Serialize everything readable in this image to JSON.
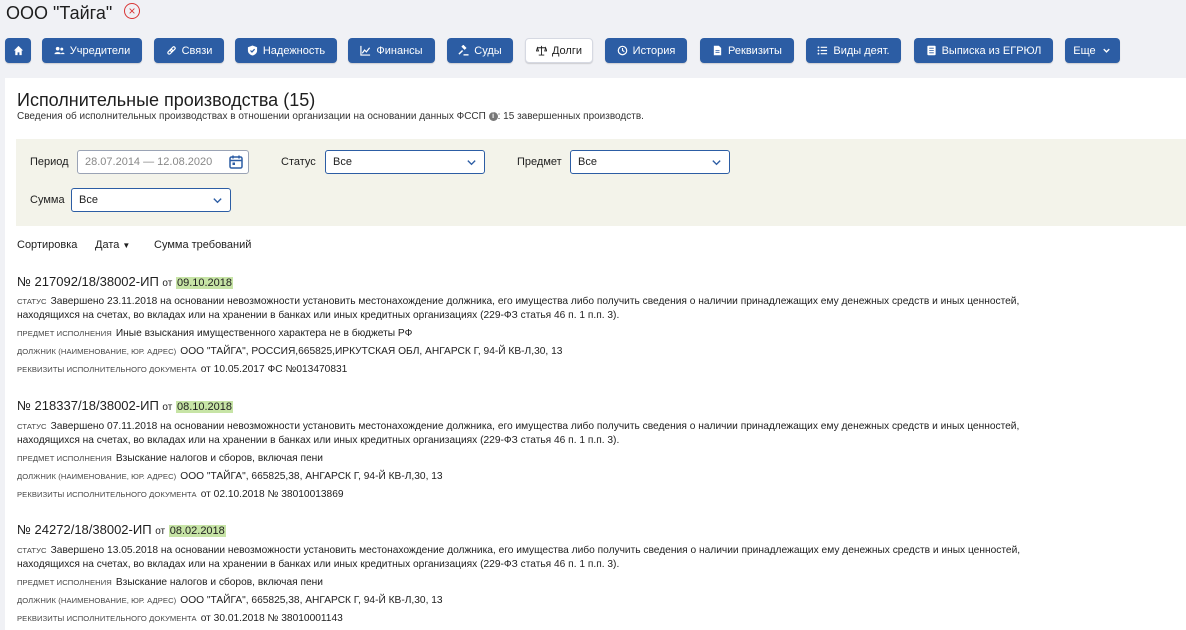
{
  "header": {
    "company": "ООО \"Тайга\"",
    "close_symbol": "×"
  },
  "nav": {
    "home_icon": "home-icon",
    "items": [
      {
        "label": "Учредители",
        "icon": "people-icon"
      },
      {
        "label": "Связи",
        "icon": "link-icon"
      },
      {
        "label": "Надежность",
        "icon": "shield-icon"
      },
      {
        "label": "Финансы",
        "icon": "chart-icon"
      },
      {
        "label": "Суды",
        "icon": "gavel-icon"
      },
      {
        "label": "Долги",
        "icon": "scales-icon",
        "active": true
      },
      {
        "label": "История",
        "icon": "history-icon"
      },
      {
        "label": "Реквизиты",
        "icon": "document-icon"
      },
      {
        "label": "Виды деят.",
        "icon": "list-icon"
      },
      {
        "label": "Выписка из ЕГРЮЛ",
        "icon": "extract-icon"
      },
      {
        "label": "Еще",
        "icon": "chevron-down-icon"
      }
    ],
    "accent": "#2c5da4"
  },
  "page": {
    "title": "Исполнительные производства (15)",
    "subtitle_before": "Сведения об исполнительных производствах в отношении организации на основании данных ФССП",
    "subtitle_after": ": 15 завершенных производств."
  },
  "filters": {
    "period_label": "Период",
    "period_value": "28.07.2014 — 12.08.2020",
    "status_label": "Статус",
    "status_value": "Все",
    "subject_label": "Предмет",
    "subject_value": "Все",
    "sum_label": "Сумма",
    "sum_value": "Все"
  },
  "sort": {
    "label": "Сортировка",
    "date": "Дата",
    "sum": "Сумма требований"
  },
  "labels": {
    "ot": "от",
    "status": "СТАТУС",
    "subject": "ПРЕДМЕТ ИСПОЛНЕНИЯ",
    "debtor": "ДОЛЖНИК (НАИМЕНОВАНИЕ, ЮР. АДРЕС)",
    "requisites": "РЕКВИЗИТЫ ИСПОЛНИТЕЛЬНОГО ДОКУМЕНТА"
  },
  "records": [
    {
      "number": "№ 217092/18/38002-ИП",
      "date": "09.10.2018",
      "status_line1": "Завершено 23.11.2018 на основании невозможности установить местонахождение должника, его имущества либо получить сведения о наличии принадлежащих ему денежных средств и иных ценностей,",
      "status_line2": "находящихся на счетах, во вкладах или на хранении в банках или иных кредитных организациях (229-ФЗ статья 46 п. 1 п.п. 3).",
      "subject": "Иные взыскания имущественного характера не в бюджеты РФ",
      "debtor": "ООО \"ТАЙГА\", РОССИЯ,665825,ИРКУТСКАЯ ОБЛ, АНГАРСК Г, 94-Й КВ-Л,30, 13",
      "requisites": "от 10.05.2017 ФС №013470831"
    },
    {
      "number": "№ 218337/18/38002-ИП",
      "date": "08.10.2018",
      "status_line1": "Завершено 07.11.2018 на основании невозможности установить местонахождение должника, его имущества либо получить сведения о наличии принадлежащих ему денежных средств и иных ценностей,",
      "status_line2": "находящихся на счетах, во вкладах или на хранении в банках или иных кредитных организациях (229-ФЗ статья 46 п. 1 п.п. 3).",
      "subject": "Взыскание налогов и сборов, включая пени",
      "debtor": "ООО \"ТАЙГА\", 665825,38, АНГАРСК Г, 94-Й КВ-Л,30, 13",
      "requisites": "от 02.10.2018 № 38010013869"
    },
    {
      "number": "№ 24272/18/38002-ИП",
      "date": "08.02.2018",
      "status_line1": "Завершено 13.05.2018 на основании невозможности установить местонахождение должника, его имущества либо получить сведения о наличии принадлежащих ему денежных средств и иных ценностей,",
      "status_line2": "находящихся на счетах, во вкладах или на хранении в банках или иных кредитных организациях (229-ФЗ статья 46 п. 1 п.п. 3).",
      "subject": "Взыскание налогов и сборов, включая пени",
      "debtor": "ООО \"ТАЙГА\", 665825,38, АНГАРСК Г, 94-Й КВ-Л,30, 13",
      "requisites": "от 30.01.2018 № 38010001143"
    }
  ]
}
